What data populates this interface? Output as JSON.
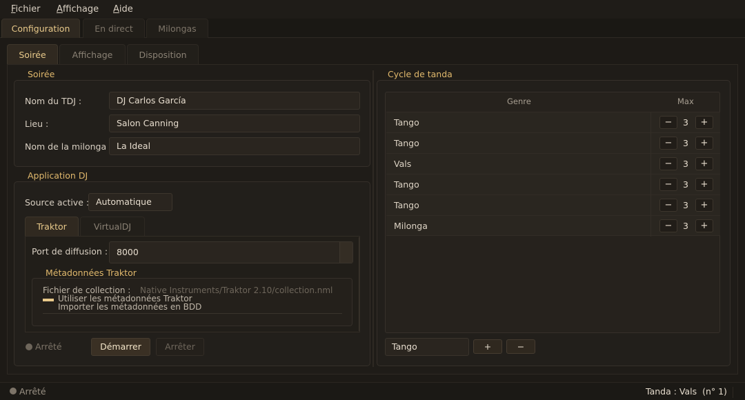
{
  "menu": {
    "fichier": {
      "u": "F",
      "rest": "ichier"
    },
    "affichage": {
      "u": "A",
      "rest": "ffichage"
    },
    "aide": {
      "u": "A",
      "rest": "ide"
    }
  },
  "main_tabs": [
    "Configuration",
    "En direct",
    "Milongas"
  ],
  "sub_tabs": [
    "Soirée",
    "Affichage",
    "Disposition"
  ],
  "soiree_group": {
    "title": "Soirée",
    "fields": [
      {
        "label": "Nom du TDJ :",
        "value": "DJ Carlos García"
      },
      {
        "label": "Lieu :",
        "value": "Salon Canning"
      },
      {
        "label": "Nom de la milonga :",
        "value": "La Ideal"
      }
    ]
  },
  "app_group": {
    "title": "Application DJ",
    "source_label": "Source active :",
    "source_value": "Automatique",
    "tabs": [
      "Traktor",
      "VirtualDJ"
    ],
    "port_label": "Port de diffusion :",
    "port_value": "8000",
    "meta_title": "Métadonnées Traktor",
    "meta_line1": "Fichier de collection :",
    "meta_line1_value": "Native Instruments/Traktor 2.10/collection.nml",
    "meta_line2": "Utiliser les métadonnées Traktor",
    "meta_line3": "Importer les métadonnées en BDD",
    "status": "Arrêté",
    "start_label": "Démarrer",
    "stop_label": "Arrêter"
  },
  "cycle_group": {
    "title": "Cycle de tanda",
    "col_genre": "Genre",
    "col_max": "Max",
    "rows": [
      {
        "genre": "Tango",
        "max": "3"
      },
      {
        "genre": "Tango",
        "max": "3"
      },
      {
        "genre": "Vals",
        "max": "3"
      },
      {
        "genre": "Tango",
        "max": "3"
      },
      {
        "genre": "Tango",
        "max": "3"
      },
      {
        "genre": "Milonga",
        "max": "3"
      }
    ],
    "minus": "−",
    "plus": "+",
    "new_genre_value": "Tango",
    "add_label": "+",
    "remove_label": "−"
  },
  "statusbar": {
    "status": "Arrêté",
    "tanda": "Tanda : Vals  (n° 1)"
  },
  "colors": {
    "accent": "#e0b86c",
    "background": "#1d1a16",
    "status_dot": "#6e665b",
    "checkbox_on": "#e8c98a"
  }
}
